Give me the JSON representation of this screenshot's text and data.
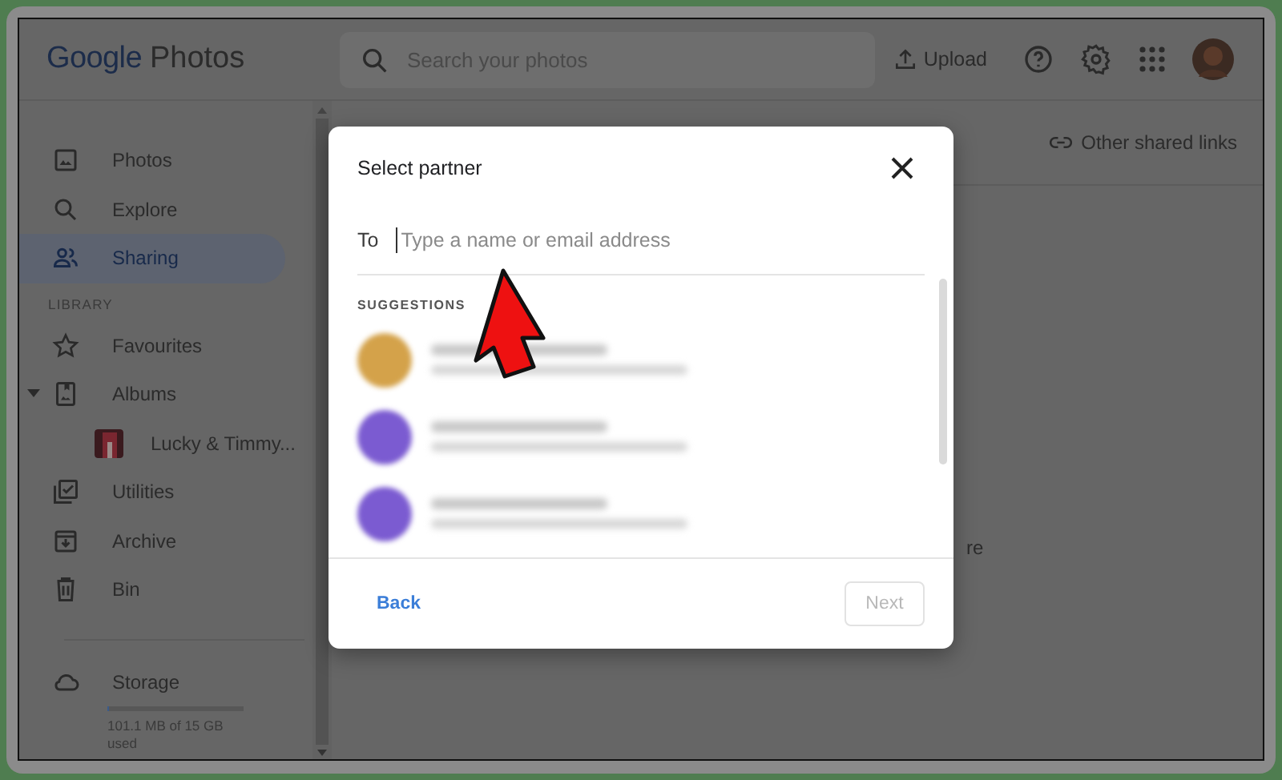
{
  "header": {
    "logo_brand": "Google",
    "logo_product": "Photos",
    "search": {
      "placeholder": "Search your photos"
    },
    "upload": "Upload"
  },
  "sidebar": {
    "items": [
      {
        "label": "Photos",
        "selected": false
      },
      {
        "label": "Explore",
        "selected": false
      },
      {
        "label": "Sharing",
        "selected": true
      }
    ],
    "section": "LIBRARY",
    "library": [
      {
        "label": "Favourites"
      },
      {
        "label": "Albums",
        "expanded": true,
        "children": [
          {
            "label": "Lucky & Timmy..."
          }
        ]
      },
      {
        "label": "Utilities"
      },
      {
        "label": "Archive"
      },
      {
        "label": "Bin"
      }
    ],
    "storage": {
      "label": "Storage",
      "level": 0.01,
      "usage": "101.1 MB of 15 GB used"
    }
  },
  "main": {
    "other_links": "Other shared links",
    "partial_text": "re"
  },
  "dialog": {
    "title": "Select partner",
    "to_label": "To",
    "input": {
      "placeholder": "Type a name or email address"
    },
    "section": "SUGGESTIONS",
    "suggestions": [
      {
        "color": "#d4a24a"
      },
      {
        "color": "#7b5bd1"
      },
      {
        "color": "#7b5bd1"
      }
    ],
    "back": "Back",
    "next": {
      "label": "Next",
      "disabled": true
    }
  }
}
